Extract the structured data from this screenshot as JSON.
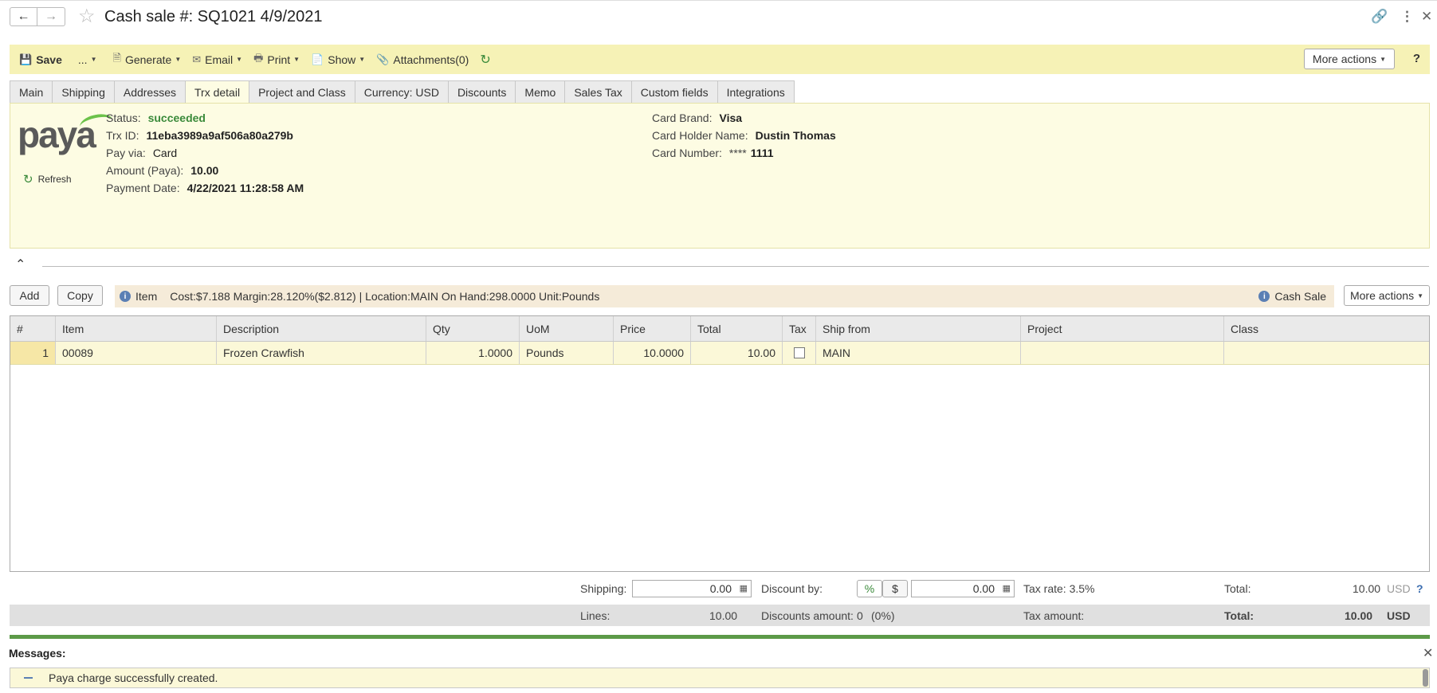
{
  "header": {
    "title": "Cash sale #: SQ1021 4/9/2021"
  },
  "toolbar": {
    "save": "Save",
    "dots": "...",
    "generate": "Generate",
    "email": "Email",
    "print": "Print",
    "show": "Show",
    "attachments": "Attachments(0)",
    "more_actions": "More actions",
    "help": "?"
  },
  "tabs": [
    "Main",
    "Shipping",
    "Addresses",
    "Trx detail",
    "Project and Class",
    "Currency: USD",
    "Discounts",
    "Memo",
    "Sales Tax",
    "Custom fields",
    "Integrations"
  ],
  "trx": {
    "logo": "paya",
    "refresh": "Refresh",
    "status_label": "Status:",
    "status": "succeeded",
    "trx_id_label": "Trx ID:",
    "trx_id": "11eba3989a9af506a80a279b",
    "pay_via_label": "Pay via:",
    "pay_via": "Card",
    "amount_label": "Amount (Paya):",
    "amount": "10.00",
    "date_label": "Payment Date:",
    "date": "4/22/2021 11:28:58 AM",
    "brand_label": "Card Brand:",
    "brand": "Visa",
    "holder_label": "Card Holder Name:",
    "holder": "Dustin Thomas",
    "number_label": "Card Number:",
    "number_mask": "****",
    "number_last": "1111"
  },
  "lines": {
    "add": "Add",
    "copy": "Copy",
    "item_label": "Item",
    "item_info": "Cost:$7.188 Margin:28.120%($2.812) | Location:MAIN On Hand:298.0000 Unit:Pounds",
    "cash_sale": "Cash Sale",
    "more_actions": "More actions",
    "columns": [
      "#",
      "Item",
      "Description",
      "Qty",
      "UoM",
      "Price",
      "Total",
      "Tax",
      "Ship from",
      "Project",
      "Class"
    ],
    "rows": [
      {
        "num": "1",
        "item": "00089",
        "description": "Frozen Crawfish",
        "qty": "1.0000",
        "uom": "Pounds",
        "price": "10.0000",
        "total": "10.00",
        "ship_from": "MAIN",
        "project": "",
        "class": ""
      }
    ]
  },
  "footer": {
    "shipping_label": "Shipping:",
    "shipping": "0.00",
    "discount_label": "Discount by:",
    "pct": "%",
    "dollar": "$",
    "discount": "0.00",
    "tax_rate": "Tax rate: 3.5%",
    "total_label": "Total:",
    "total": "10.00",
    "currency": "USD",
    "help": "?",
    "lines_label": "Lines:",
    "lines": "10.00",
    "discounts_amount_label": "Discounts amount:",
    "discounts_amount": "0",
    "discounts_pct": "(0%)",
    "tax_amount_label": "Tax amount:",
    "grand_total_label": "Total:",
    "grand_total": "10.00",
    "grand_currency": "USD"
  },
  "messages": {
    "title": "Messages:",
    "text": "Paya charge successfully created."
  }
}
